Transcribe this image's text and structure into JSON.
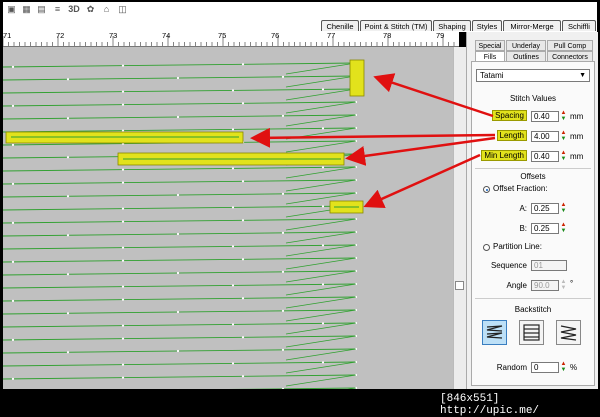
{
  "toolbar": {
    "icons": [
      "save-icon",
      "grid-icon",
      "print-icon",
      "list-icon",
      "3d-view-icon",
      "palette-icon",
      "shirt-icon",
      "frame-icon"
    ],
    "threed_label": "3D"
  },
  "top_tabs": [
    "Chenille",
    "Point & Stitch (TM)",
    "Shaping",
    "Styles",
    "Mirror-Merge",
    "Schiffli"
  ],
  "ruler": {
    "labels": [
      "71",
      "72",
      "73",
      "74",
      "75",
      "76",
      "77",
      "78",
      "79"
    ]
  },
  "panel": {
    "tabs_row1": [
      "Special",
      "Underlay",
      "Pull Comp"
    ],
    "tabs_row2": [
      "Fills",
      "Outlines",
      "Connectors"
    ],
    "fill_type": "Tatami",
    "stitch_values_title": "Stitch Values",
    "spacing": {
      "label": "Spacing",
      "value": "0.40",
      "unit": "mm"
    },
    "length": {
      "label": "Length",
      "value": "4.00",
      "unit": "mm"
    },
    "min_length": {
      "label": "Min Length",
      "value": "0.40",
      "unit": "mm"
    },
    "offsets_title": "Offsets",
    "offset_fraction": {
      "label": "Offset Fraction:",
      "selected": true
    },
    "offset_a": {
      "label": "A:",
      "value": "0.25"
    },
    "offset_b": {
      "label": "B:",
      "value": "0.25"
    },
    "partition_line": {
      "label": "Partition Line:",
      "selected": false
    },
    "sequence": {
      "label": "Sequence",
      "value": "01"
    },
    "angle": {
      "label": "Angle",
      "value": "90.0",
      "unit": "°"
    },
    "backstitch_title": "Backstitch",
    "random": {
      "label": "Random",
      "value": "0",
      "unit": "%"
    }
  },
  "watermark": "[846x551]  http://upic.me/",
  "colors": {
    "stitch": "#2fa02f",
    "highlight": "#e2e21c",
    "arrow": "#e01010",
    "canvas": "#c0c0c0"
  }
}
